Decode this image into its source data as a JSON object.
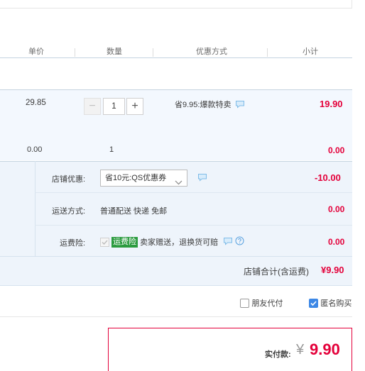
{
  "header": {
    "col_unit_price": "单价",
    "col_quantity": "数量",
    "col_discount": "优惠方式",
    "col_subtotal": "小计"
  },
  "item": {
    "unit_price": "29.85",
    "quantity": "1",
    "minus": "−",
    "plus": "+",
    "promo": "省9.95:爆款特卖",
    "subtotal": "19.90"
  },
  "summary_row": {
    "price": "0.00",
    "quantity": "1",
    "subtotal": "0.00"
  },
  "shop": {
    "coupon_label": "店铺优惠:",
    "coupon_value": "省10元:QS优惠券",
    "coupon_amount": "-10.00",
    "shipping_label": "运送方式:",
    "shipping_value": "普通配送 快递 免邮",
    "shipping_amount": "0.00",
    "insurance_label": "运费险:",
    "insurance_badge": "运费险",
    "insurance_desc": "卖家赠送，退换货可赔",
    "insurance_amount": "0.00",
    "total_label": "店铺合计(含运费)",
    "total_value": "¥9.90"
  },
  "options": {
    "friend_pay": "朋友代付",
    "friend_pay_checked": false,
    "anonymous": "匿名购买",
    "anonymous_checked": true
  },
  "payment": {
    "label": "实付款:",
    "currency": "¥",
    "amount": "9.90"
  },
  "colors": {
    "accent_red": "#e4003a",
    "link_blue": "#3d88e6",
    "insurance_green": "#2b9b3f",
    "row_bg": "#eef4fb"
  }
}
